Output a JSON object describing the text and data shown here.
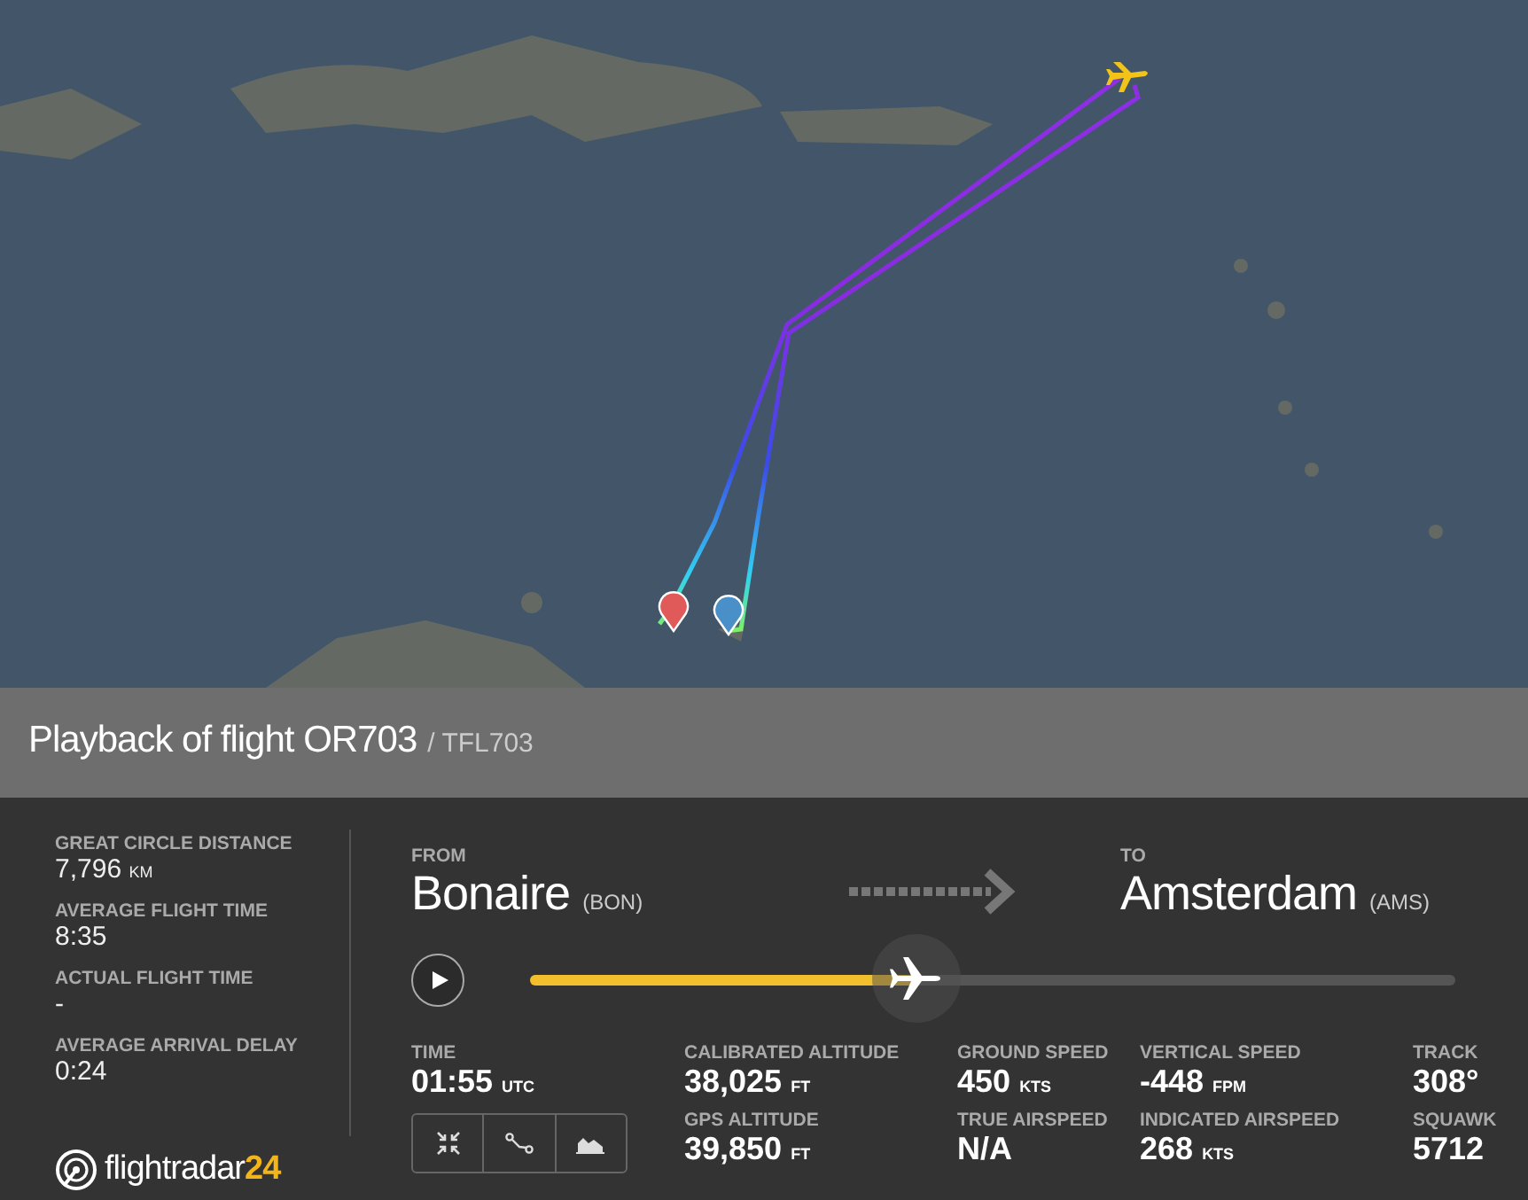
{
  "header": {
    "title": "Playback of flight OR703",
    "callsign": "/ TFL703"
  },
  "stats": [
    {
      "label": "GREAT CIRCLE DISTANCE",
      "value": "7,796",
      "unit": "KM"
    },
    {
      "label": "AVERAGE FLIGHT TIME",
      "value": "8:35"
    },
    {
      "label": "ACTUAL FLIGHT TIME",
      "value": "-"
    },
    {
      "label": "AVERAGE ARRIVAL DELAY",
      "value": "0:24"
    }
  ],
  "logo": {
    "text": "flightradar",
    "number": "24"
  },
  "route": {
    "from": {
      "label": "FROM",
      "city": "Bonaire",
      "code": "(BON)"
    },
    "to": {
      "label": "TO",
      "city": "Amsterdam",
      "code": "(AMS)"
    }
  },
  "playback": {
    "level": 0.42
  },
  "time": {
    "label": "TIME",
    "value": "01:55",
    "unit": "UTC"
  },
  "telemetry": [
    {
      "label": "CALIBRATED ALTITUDE",
      "value": "38,025",
      "unit": "FT"
    },
    {
      "label": "GROUND SPEED",
      "value": "450",
      "unit": "KTS"
    },
    {
      "label": "VERTICAL SPEED",
      "value": "-448",
      "unit": "FPM"
    },
    {
      "label": "TRACK",
      "value": "308°"
    },
    {
      "label": "GPS ALTITUDE",
      "value": "39,850",
      "unit": "FT"
    },
    {
      "label": "TRUE AIRSPEED",
      "value": "N/A"
    },
    {
      "label": "INDICATED AIRSPEED",
      "value": "268",
      "unit": "KTS"
    },
    {
      "label": "SQUAWK",
      "value": "5712"
    }
  ]
}
